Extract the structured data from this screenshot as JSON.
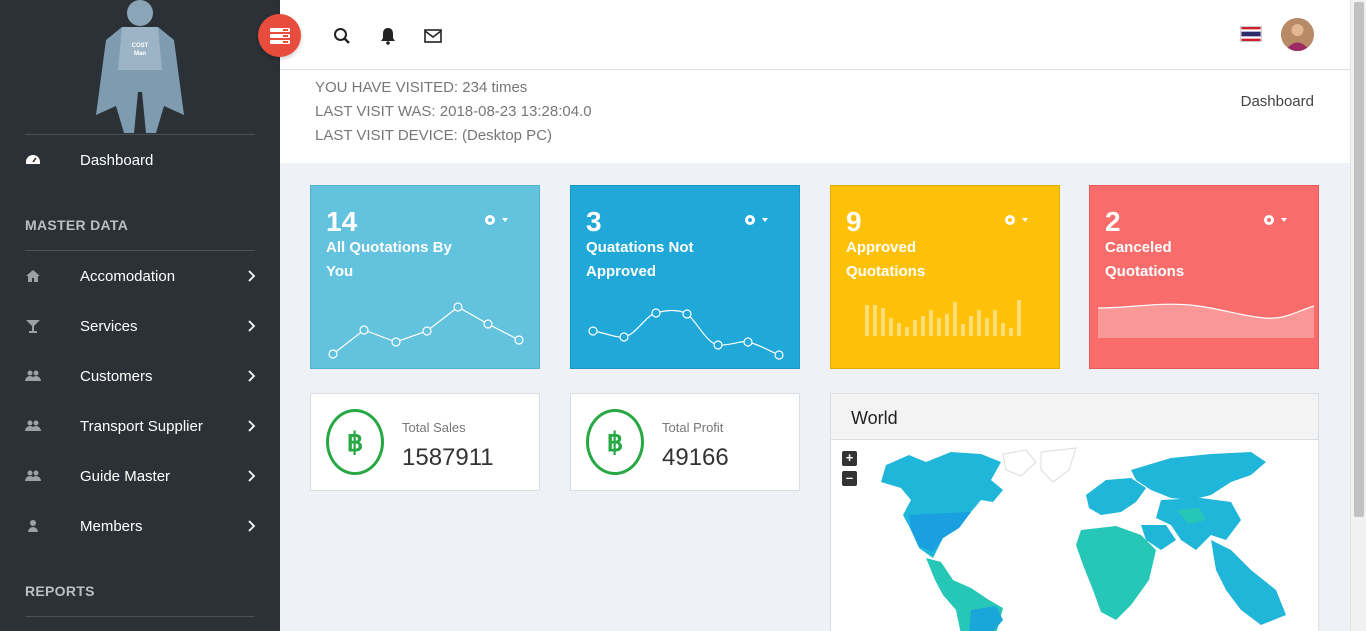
{
  "sidebar": {
    "logo_text": [
      "COST",
      "Man"
    ],
    "dashboard": "Dashboard",
    "section_master": "MASTER DATA",
    "items": [
      {
        "label": "Accomodation",
        "icon": "home-icon"
      },
      {
        "label": "Services",
        "icon": "glass-icon"
      },
      {
        "label": "Customers",
        "icon": "users-icon"
      },
      {
        "label": "Transport Supplier",
        "icon": "users-icon"
      },
      {
        "label": "Guide Master",
        "icon": "users-icon"
      },
      {
        "label": "Members",
        "icon": "user-icon"
      }
    ],
    "section_reports": "REPORTS"
  },
  "topbar": {
    "icons": [
      "search-icon",
      "bell-icon",
      "envelope-icon"
    ],
    "language_flag": "thailand-flag"
  },
  "visit": {
    "visited": "YOU HAVE VISITED: 234 times",
    "last_visit": "LAST VISIT WAS: 2018-08-23 13:28:04.0",
    "device": "LAST VISIT DEVICE: (Desktop PC)",
    "crumb": "Dashboard"
  },
  "stats": [
    {
      "num": "14",
      "label": "All Quotations By You",
      "color": "#63c2de"
    },
    {
      "num": "3",
      "label": "Quatations Not Approved",
      "color": "#20a8d8"
    },
    {
      "num": "9",
      "label": "Approved Quotations",
      "color": "#ffc107"
    },
    {
      "num": "2",
      "label": "Canceled Quotations",
      "color": "#f86c6b"
    }
  ],
  "totals": [
    {
      "label": "Total Sales",
      "value": "1587911",
      "symbol": "฿"
    },
    {
      "label": "Total Profit",
      "value": "49166",
      "symbol": "฿"
    }
  ],
  "world": {
    "title": "World",
    "zoom_in": "+",
    "zoom_out": "–"
  },
  "colors": {
    "sidebar": "#2b3136",
    "toggle": "#e74c3c",
    "success": "#27a844"
  }
}
